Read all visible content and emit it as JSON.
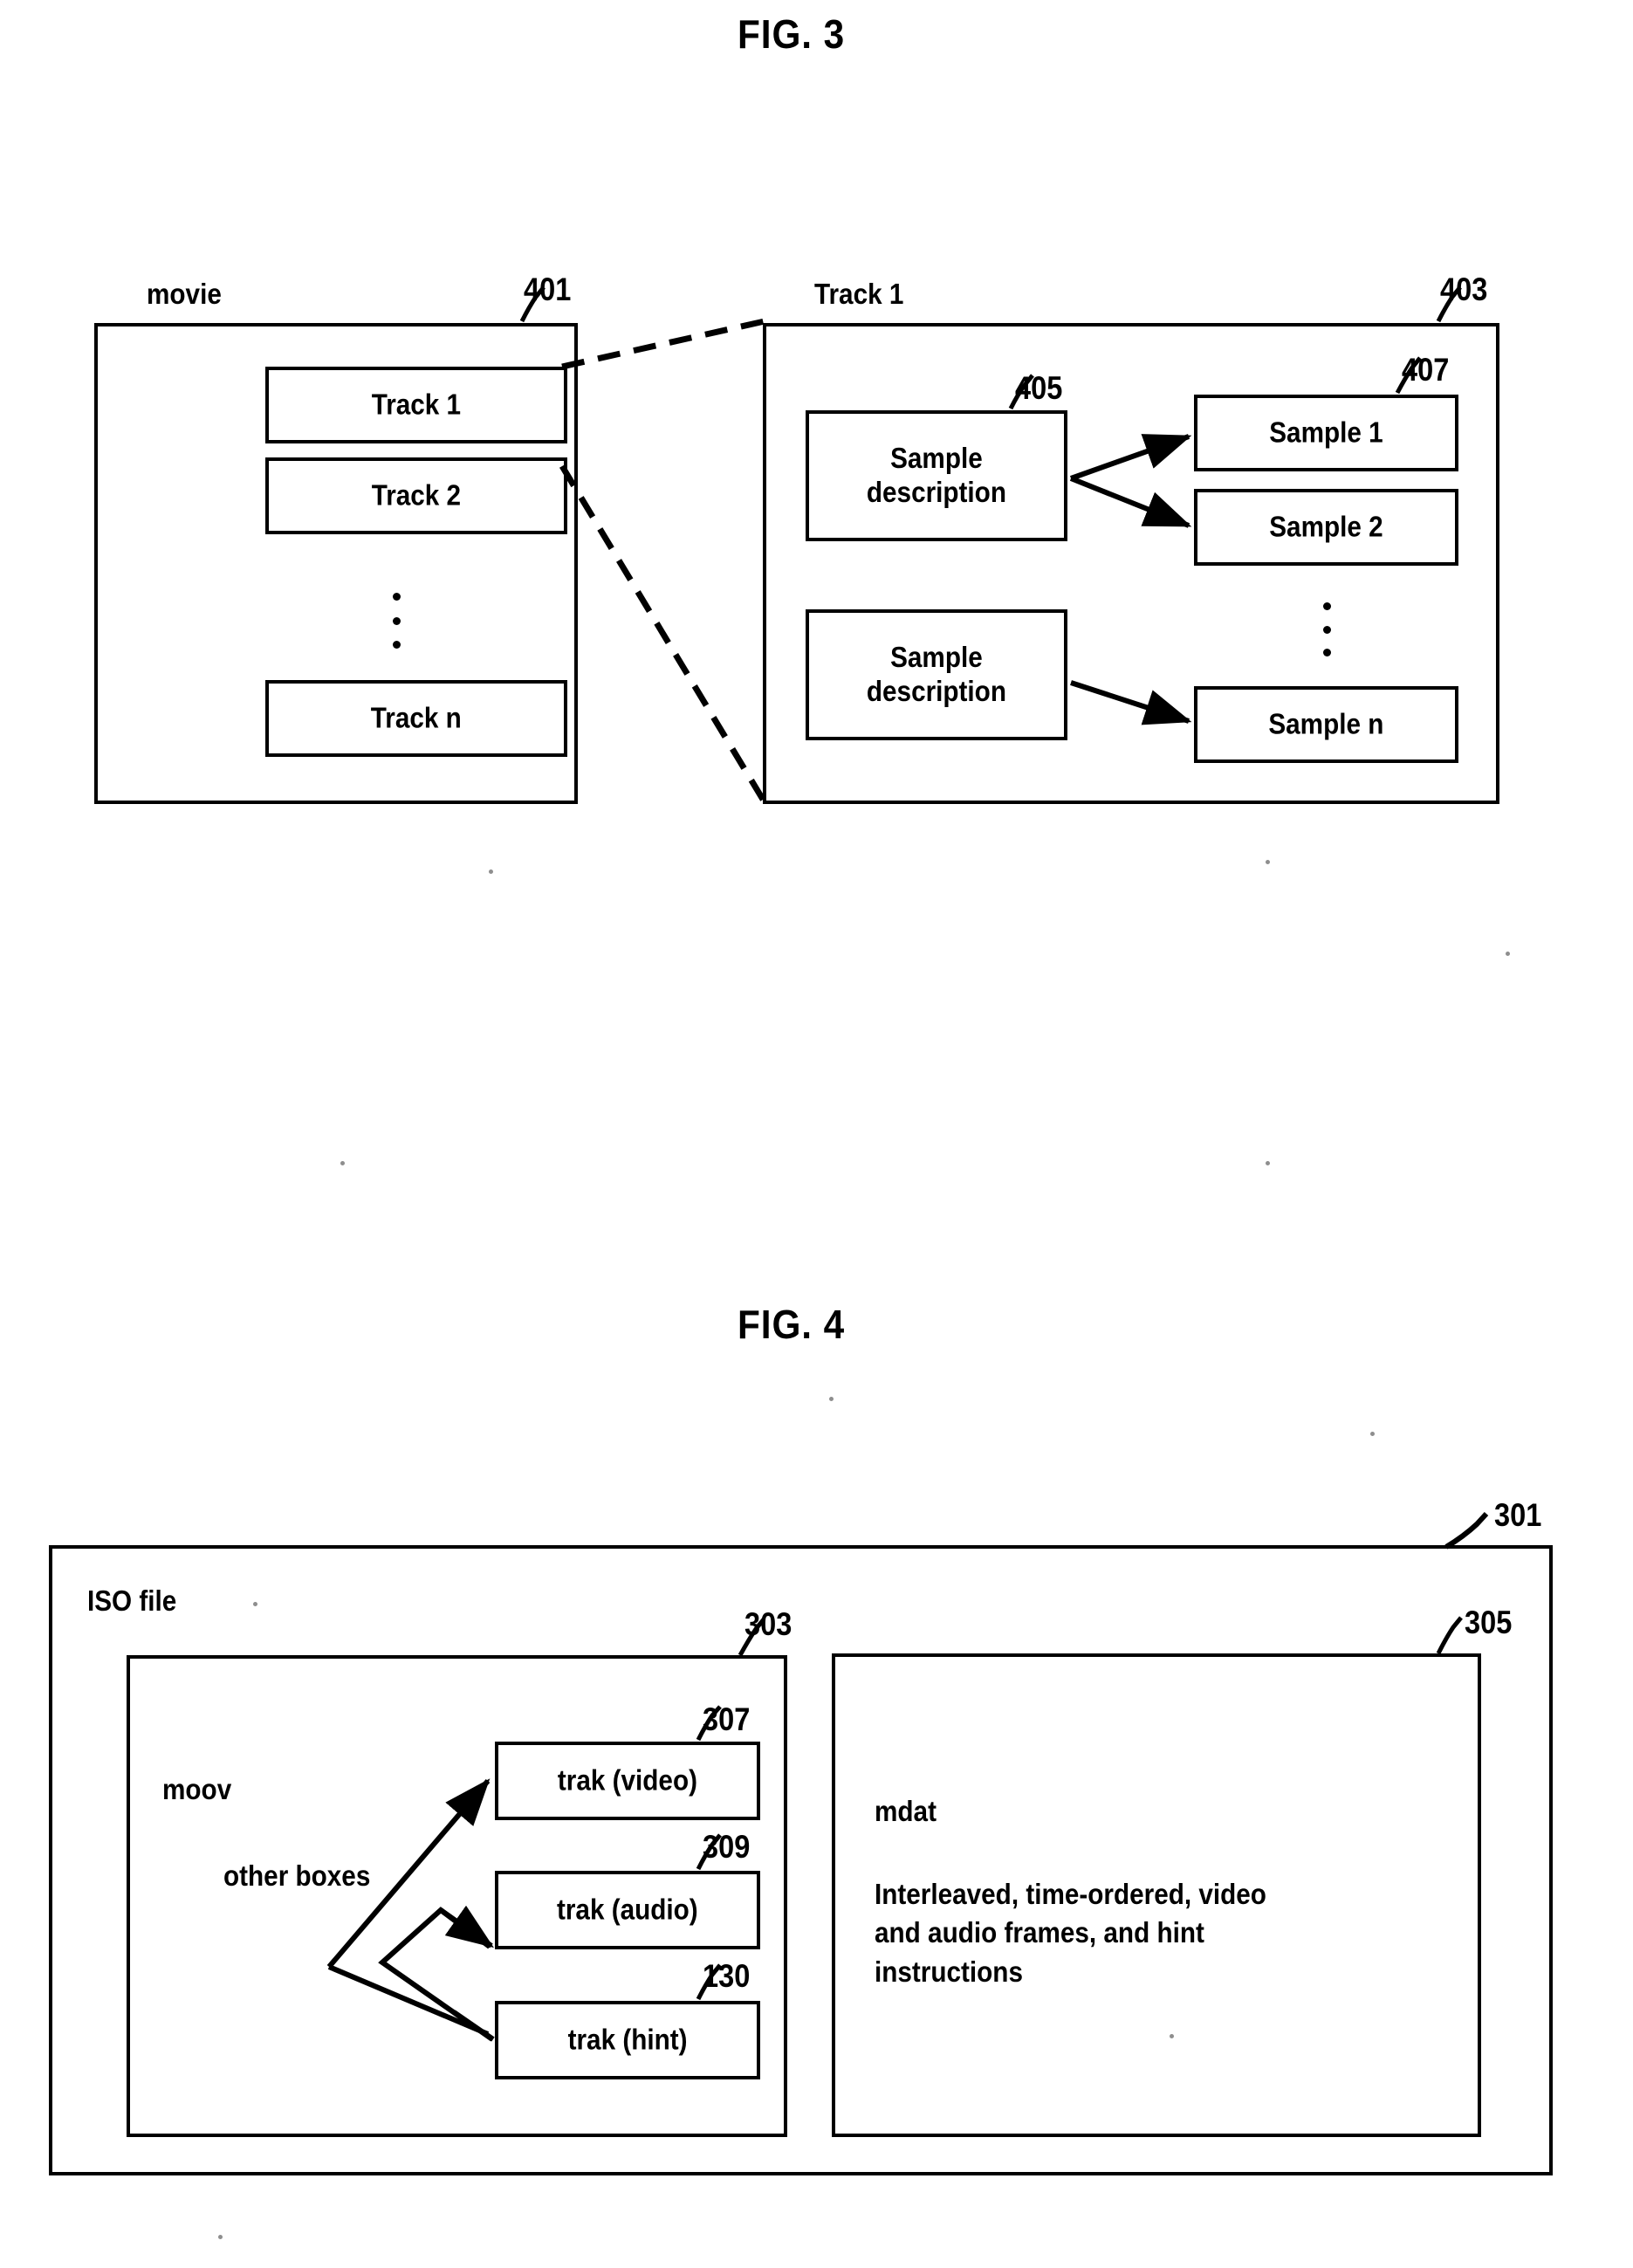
{
  "figures": [
    {
      "title": "FIG. 3",
      "movie_panel": {
        "caption": "movie",
        "ref": "401",
        "tracks": [
          {
            "label": "Track 1"
          },
          {
            "label": "Track 2"
          },
          {
            "label": "Track n"
          }
        ],
        "ellipsis": "⋮"
      },
      "track_panel": {
        "caption": "Track 1",
        "ref": "403",
        "sample_description_ref": "405",
        "sample_ref": "407",
        "sample_descriptions": [
          {
            "label": "Sample\ndescription"
          },
          {
            "label": "Sample\ndescription"
          }
        ],
        "samples": [
          {
            "label": "Sample 1"
          },
          {
            "label": "Sample 2"
          },
          {
            "label": "Sample n"
          }
        ],
        "ellipsis": "⋮"
      }
    },
    {
      "title": "FIG. 4",
      "iso_file": {
        "caption": "ISO file",
        "ref": "301",
        "moov": {
          "ref": "303",
          "label_line1": "moov",
          "label_line2": "other boxes",
          "traks": [
            {
              "label": "trak (video)",
              "ref": "307"
            },
            {
              "label": "trak (audio)",
              "ref": "309"
            },
            {
              "label": "trak (hint)",
              "ref": "130"
            }
          ]
        },
        "mdat": {
          "ref": "305",
          "label": "mdat",
          "description": "Interleaved, time-ordered, video\nand audio frames, and hint\ninstructions"
        }
      }
    }
  ],
  "colors": {
    "ink": "#000000",
    "paper": "#ffffff"
  }
}
